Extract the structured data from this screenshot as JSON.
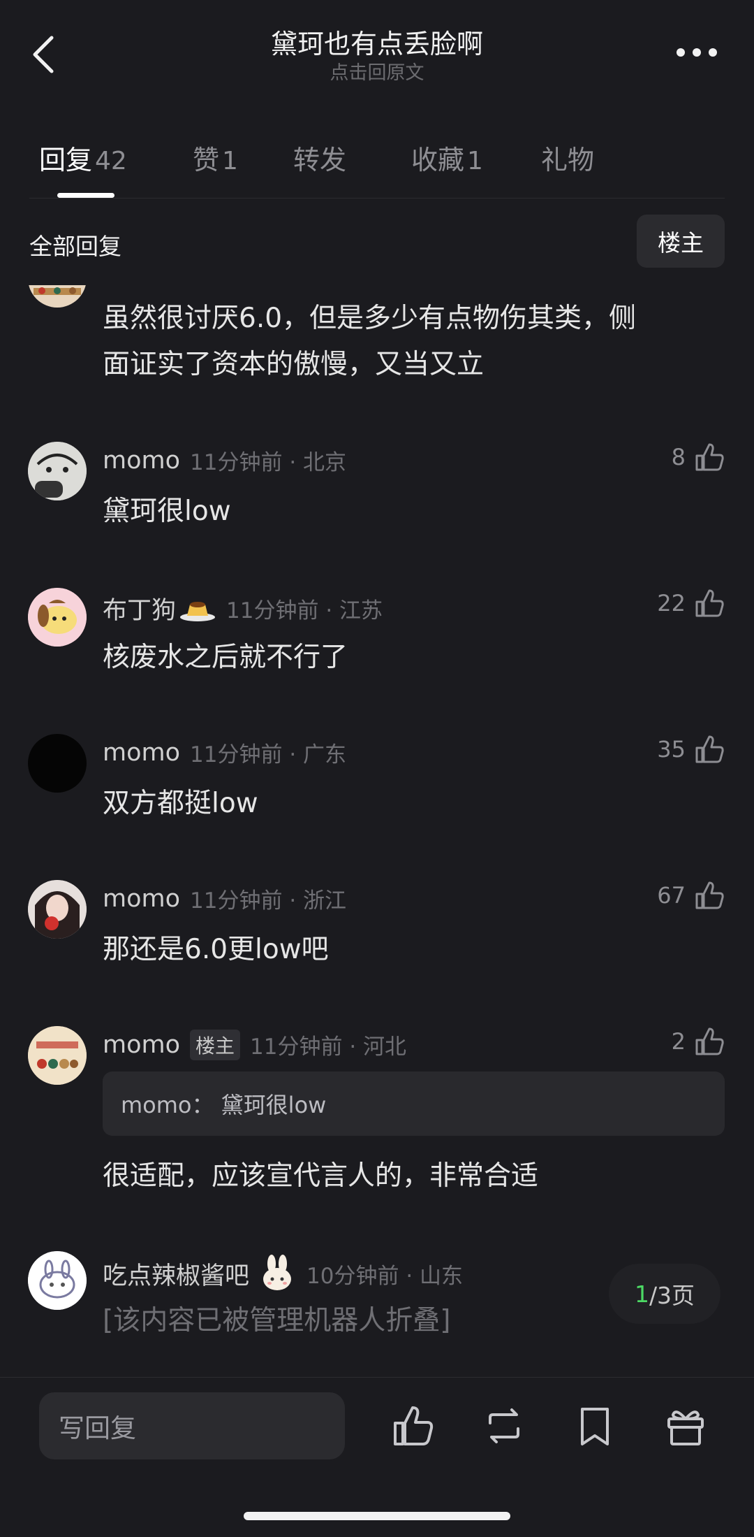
{
  "header": {
    "title": "黛珂也有点丢脸啊",
    "subtitle": "点击回原文"
  },
  "tabs": [
    {
      "label": "回复",
      "count": "42",
      "active": true
    },
    {
      "label": "赞",
      "count": "1"
    },
    {
      "label": "转发",
      "count": ""
    },
    {
      "label": "收藏",
      "count": "1"
    },
    {
      "label": "礼物",
      "count": ""
    }
  ],
  "section": {
    "title": "全部回复",
    "owner_button": "楼主"
  },
  "partial_comment": {
    "text_line1": "虽然很讨厌6.0，但是多少有点物伤其类，侧",
    "text_line2": "面证实了资本的傲慢，又当又立"
  },
  "comments": [
    {
      "user": "momo",
      "time": "11分钟前 · 北京",
      "likes": "8",
      "text": "黛珂很low"
    },
    {
      "user": "布丁狗",
      "time": "11分钟前 · 江苏",
      "likes": "22",
      "text": "核废水之后就不行了"
    },
    {
      "user": "momo",
      "time": "11分钟前 · 广东",
      "likes": "35",
      "text": "双方都挺low"
    },
    {
      "user": "momo",
      "time": "11分钟前 · 浙江",
      "likes": "67",
      "text": "那还是6.0更low吧"
    },
    {
      "user": "momo",
      "badge": "楼主",
      "time": "11分钟前 · 河北",
      "likes": "2",
      "quote": "momo：  黛珂很low",
      "text": "很适配，应该宣代言人的，非常合适"
    },
    {
      "user": "吃点辣椒酱吧",
      "time": "10分钟前 · 山东",
      "text": "[该内容已被管理机器人折叠]"
    }
  ],
  "pager": {
    "current": "1",
    "total_text": "/3页"
  },
  "bottom": {
    "reply_placeholder": "写回复"
  },
  "colors": {
    "background": "#1b1b1f",
    "accent_green": "#4cd964"
  }
}
